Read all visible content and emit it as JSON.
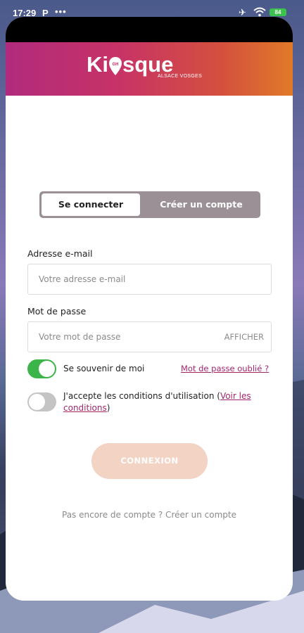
{
  "status_bar": {
    "time": "17:29",
    "indicator": "P",
    "dots": "•••",
    "battery": "84"
  },
  "brand": {
    "name_k": "Ki",
    "name_rest": "sque",
    "pin_text": "GH",
    "subtitle": "ALSACE VOSGES",
    "gradient_colors": [
      "#b12a7d",
      "#d4503e",
      "#e07a28"
    ]
  },
  "tabs": {
    "login": "Se connecter",
    "signup": "Créer un compte",
    "active": "login"
  },
  "email": {
    "label": "Adresse e-mail",
    "placeholder": "Votre adresse e-mail",
    "value": ""
  },
  "password": {
    "label": "Mot de passe",
    "placeholder": "Votre mot de passe",
    "value": "",
    "show_label": "AFFICHER"
  },
  "remember": {
    "label": "Se souvenir de moi",
    "checked": true,
    "forgot_link": "Mot de passe oublié ?"
  },
  "terms": {
    "text_before": "J'accepte les conditions d'utilisation (",
    "link": "Voir les conditions",
    "text_after": ")",
    "checked": false
  },
  "submit": {
    "label": "CONNEXION"
  },
  "footer": {
    "text": "Pas encore de compte ? Créer un compte"
  },
  "colors": {
    "accent": "#a1256e",
    "toggle_on": "#3bb54a",
    "toggle_off": "#c4c4c4",
    "button_disabled": "#f3d4c4"
  }
}
